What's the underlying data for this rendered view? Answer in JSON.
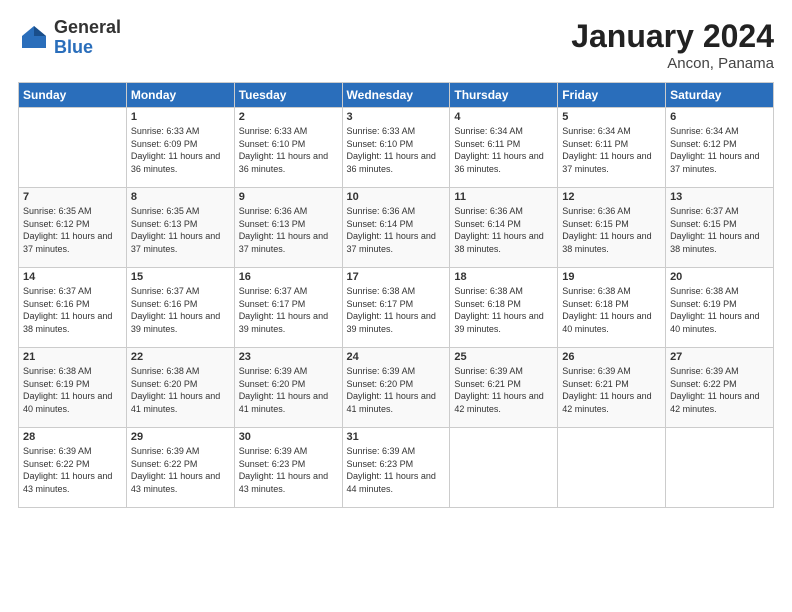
{
  "logo": {
    "general": "General",
    "blue": "Blue"
  },
  "title": "January 2024",
  "subtitle": "Ancon, Panama",
  "days_header": [
    "Sunday",
    "Monday",
    "Tuesday",
    "Wednesday",
    "Thursday",
    "Friday",
    "Saturday"
  ],
  "weeks": [
    [
      {
        "day": "",
        "sunrise": "",
        "sunset": "",
        "daylight": ""
      },
      {
        "day": "1",
        "sunrise": "Sunrise: 6:33 AM",
        "sunset": "Sunset: 6:09 PM",
        "daylight": "Daylight: 11 hours and 36 minutes."
      },
      {
        "day": "2",
        "sunrise": "Sunrise: 6:33 AM",
        "sunset": "Sunset: 6:10 PM",
        "daylight": "Daylight: 11 hours and 36 minutes."
      },
      {
        "day": "3",
        "sunrise": "Sunrise: 6:33 AM",
        "sunset": "Sunset: 6:10 PM",
        "daylight": "Daylight: 11 hours and 36 minutes."
      },
      {
        "day": "4",
        "sunrise": "Sunrise: 6:34 AM",
        "sunset": "Sunset: 6:11 PM",
        "daylight": "Daylight: 11 hours and 36 minutes."
      },
      {
        "day": "5",
        "sunrise": "Sunrise: 6:34 AM",
        "sunset": "Sunset: 6:11 PM",
        "daylight": "Daylight: 11 hours and 37 minutes."
      },
      {
        "day": "6",
        "sunrise": "Sunrise: 6:34 AM",
        "sunset": "Sunset: 6:12 PM",
        "daylight": "Daylight: 11 hours and 37 minutes."
      }
    ],
    [
      {
        "day": "7",
        "sunrise": "Sunrise: 6:35 AM",
        "sunset": "Sunset: 6:12 PM",
        "daylight": "Daylight: 11 hours and 37 minutes."
      },
      {
        "day": "8",
        "sunrise": "Sunrise: 6:35 AM",
        "sunset": "Sunset: 6:13 PM",
        "daylight": "Daylight: 11 hours and 37 minutes."
      },
      {
        "day": "9",
        "sunrise": "Sunrise: 6:36 AM",
        "sunset": "Sunset: 6:13 PM",
        "daylight": "Daylight: 11 hours and 37 minutes."
      },
      {
        "day": "10",
        "sunrise": "Sunrise: 6:36 AM",
        "sunset": "Sunset: 6:14 PM",
        "daylight": "Daylight: 11 hours and 37 minutes."
      },
      {
        "day": "11",
        "sunrise": "Sunrise: 6:36 AM",
        "sunset": "Sunset: 6:14 PM",
        "daylight": "Daylight: 11 hours and 38 minutes."
      },
      {
        "day": "12",
        "sunrise": "Sunrise: 6:36 AM",
        "sunset": "Sunset: 6:15 PM",
        "daylight": "Daylight: 11 hours and 38 minutes."
      },
      {
        "day": "13",
        "sunrise": "Sunrise: 6:37 AM",
        "sunset": "Sunset: 6:15 PM",
        "daylight": "Daylight: 11 hours and 38 minutes."
      }
    ],
    [
      {
        "day": "14",
        "sunrise": "Sunrise: 6:37 AM",
        "sunset": "Sunset: 6:16 PM",
        "daylight": "Daylight: 11 hours and 38 minutes."
      },
      {
        "day": "15",
        "sunrise": "Sunrise: 6:37 AM",
        "sunset": "Sunset: 6:16 PM",
        "daylight": "Daylight: 11 hours and 39 minutes."
      },
      {
        "day": "16",
        "sunrise": "Sunrise: 6:37 AM",
        "sunset": "Sunset: 6:17 PM",
        "daylight": "Daylight: 11 hours and 39 minutes."
      },
      {
        "day": "17",
        "sunrise": "Sunrise: 6:38 AM",
        "sunset": "Sunset: 6:17 PM",
        "daylight": "Daylight: 11 hours and 39 minutes."
      },
      {
        "day": "18",
        "sunrise": "Sunrise: 6:38 AM",
        "sunset": "Sunset: 6:18 PM",
        "daylight": "Daylight: 11 hours and 39 minutes."
      },
      {
        "day": "19",
        "sunrise": "Sunrise: 6:38 AM",
        "sunset": "Sunset: 6:18 PM",
        "daylight": "Daylight: 11 hours and 40 minutes."
      },
      {
        "day": "20",
        "sunrise": "Sunrise: 6:38 AM",
        "sunset": "Sunset: 6:19 PM",
        "daylight": "Daylight: 11 hours and 40 minutes."
      }
    ],
    [
      {
        "day": "21",
        "sunrise": "Sunrise: 6:38 AM",
        "sunset": "Sunset: 6:19 PM",
        "daylight": "Daylight: 11 hours and 40 minutes."
      },
      {
        "day": "22",
        "sunrise": "Sunrise: 6:38 AM",
        "sunset": "Sunset: 6:20 PM",
        "daylight": "Daylight: 11 hours and 41 minutes."
      },
      {
        "day": "23",
        "sunrise": "Sunrise: 6:39 AM",
        "sunset": "Sunset: 6:20 PM",
        "daylight": "Daylight: 11 hours and 41 minutes."
      },
      {
        "day": "24",
        "sunrise": "Sunrise: 6:39 AM",
        "sunset": "Sunset: 6:20 PM",
        "daylight": "Daylight: 11 hours and 41 minutes."
      },
      {
        "day": "25",
        "sunrise": "Sunrise: 6:39 AM",
        "sunset": "Sunset: 6:21 PM",
        "daylight": "Daylight: 11 hours and 42 minutes."
      },
      {
        "day": "26",
        "sunrise": "Sunrise: 6:39 AM",
        "sunset": "Sunset: 6:21 PM",
        "daylight": "Daylight: 11 hours and 42 minutes."
      },
      {
        "day": "27",
        "sunrise": "Sunrise: 6:39 AM",
        "sunset": "Sunset: 6:22 PM",
        "daylight": "Daylight: 11 hours and 42 minutes."
      }
    ],
    [
      {
        "day": "28",
        "sunrise": "Sunrise: 6:39 AM",
        "sunset": "Sunset: 6:22 PM",
        "daylight": "Daylight: 11 hours and 43 minutes."
      },
      {
        "day": "29",
        "sunrise": "Sunrise: 6:39 AM",
        "sunset": "Sunset: 6:22 PM",
        "daylight": "Daylight: 11 hours and 43 minutes."
      },
      {
        "day": "30",
        "sunrise": "Sunrise: 6:39 AM",
        "sunset": "Sunset: 6:23 PM",
        "daylight": "Daylight: 11 hours and 43 minutes."
      },
      {
        "day": "31",
        "sunrise": "Sunrise: 6:39 AM",
        "sunset": "Sunset: 6:23 PM",
        "daylight": "Daylight: 11 hours and 44 minutes."
      },
      {
        "day": "",
        "sunrise": "",
        "sunset": "",
        "daylight": ""
      },
      {
        "day": "",
        "sunrise": "",
        "sunset": "",
        "daylight": ""
      },
      {
        "day": "",
        "sunrise": "",
        "sunset": "",
        "daylight": ""
      }
    ]
  ]
}
